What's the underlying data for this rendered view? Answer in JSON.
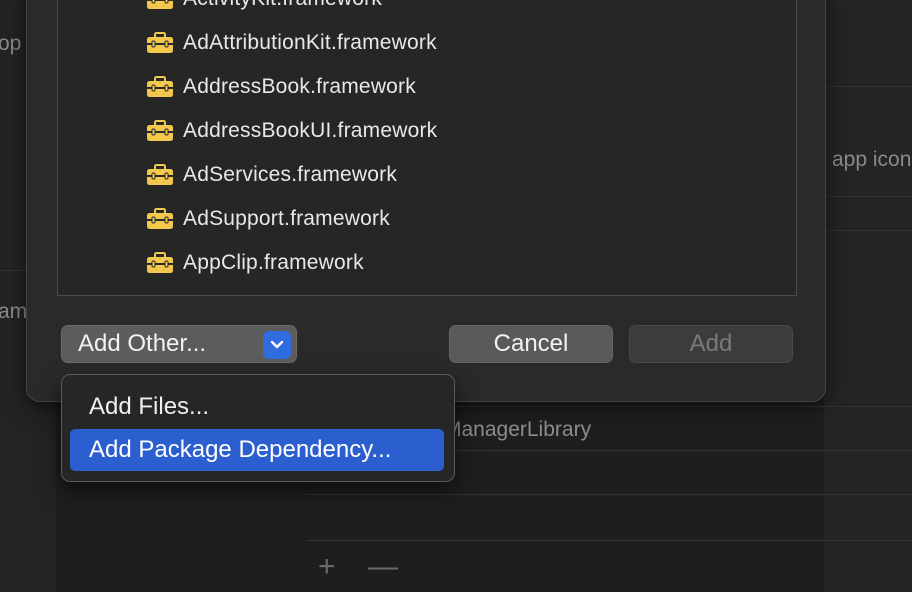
{
  "background": {
    "left_fragments": [
      "op",
      "am"
    ],
    "right_fragment": "app icon",
    "middle_fragment": "ManagerLibrary",
    "plus_label": "+",
    "minus_label": "—"
  },
  "framework_list": {
    "items": [
      {
        "label": "ActivityKit.framework",
        "icon": "toolbox-icon"
      },
      {
        "label": "AdAttributionKit.framework",
        "icon": "toolbox-icon"
      },
      {
        "label": "AddressBook.framework",
        "icon": "toolbox-icon"
      },
      {
        "label": "AddressBookUI.framework",
        "icon": "toolbox-icon"
      },
      {
        "label": "AdServices.framework",
        "icon": "toolbox-icon"
      },
      {
        "label": "AdSupport.framework",
        "icon": "toolbox-icon"
      },
      {
        "label": "AppClip.framework",
        "icon": "toolbox-icon"
      }
    ]
  },
  "buttons": {
    "add_other": "Add Other...",
    "cancel": "Cancel",
    "add": "Add"
  },
  "menu": {
    "items": [
      {
        "label": "Add Files..."
      },
      {
        "label": "Add Package Dependency..."
      }
    ],
    "selected_index": 1
  },
  "colors": {
    "accent": "#2b5fd0",
    "icon_yellow": "#f2c94c"
  }
}
